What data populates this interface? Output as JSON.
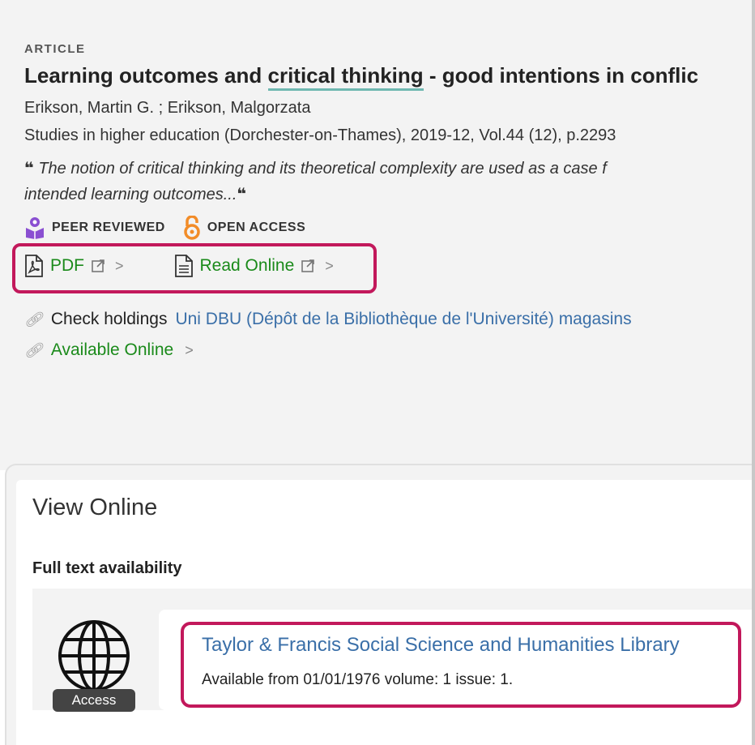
{
  "record": {
    "type_label": "ARTICLE",
    "title_before": "Learning outcomes and ",
    "title_highlight": "critical thinking",
    "title_after": " - good intentions in conflic",
    "authors": "Erikson, Martin G. ; Erikson, Malgorzata",
    "source": "Studies in higher education (Dorchester-on-Thames), 2019-12, Vol.44 (12), p.2293",
    "snippet_line1": "The notion of critical thinking and its theoretical complexity are used as a case f",
    "snippet_line2": "intended learning outcomes...",
    "quote_glyph": "❝"
  },
  "badges": {
    "peer_reviewed": "PEER REVIEWED",
    "open_access": "OPEN ACCESS"
  },
  "links": {
    "pdf_label": "PDF",
    "read_online_label": "Read Online"
  },
  "holdings": {
    "check_label": "Check holdings",
    "location": "Uni DBU (Dépôt de la Bibliothèque de l'Université)  magasins",
    "available_online": "Available Online"
  },
  "view_online": {
    "title": "View Online",
    "full_text_heading": "Full text availability",
    "access_badge": "Access",
    "provider": "Taylor & Francis Social Science and Humanities Library",
    "coverage": "Available from 01/01/1976 volume: 1 issue: 1."
  },
  "colors": {
    "highlight_box": "#c2185b",
    "link_green": "#1a8a1a",
    "link_blue": "#3a6fa8",
    "peer_reviewed_purple": "#8a4fd1",
    "open_access_orange": "#f28c28"
  }
}
